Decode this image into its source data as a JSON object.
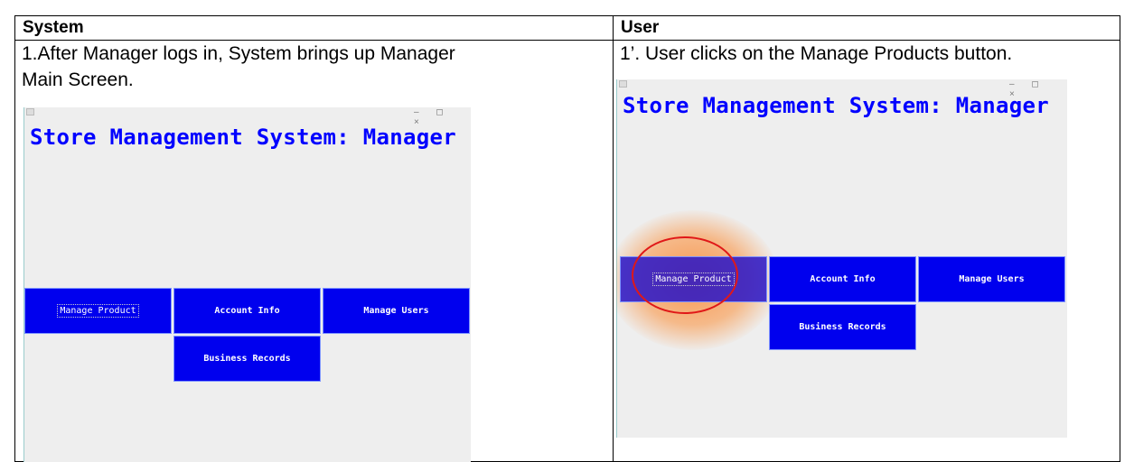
{
  "columns": {
    "system": "System",
    "user": "User"
  },
  "steps": {
    "system_line1": "1.After Manager logs in, System brings up Manager",
    "system_line2": "Main Screen.",
    "user_line1": "1’. User clicks on the Manage Products button."
  },
  "window": {
    "title": "Store Management System: Manager",
    "controls": "– ◻ ×",
    "buttons": {
      "manage_product": "Manage Product",
      "account_info": "Account Info",
      "manage_users": "Manage Users",
      "business_records": "Business Records"
    }
  },
  "colors": {
    "title_text": "#0000ff",
    "button_bg": "#0000ee",
    "highlight_ring": "#e01818"
  }
}
